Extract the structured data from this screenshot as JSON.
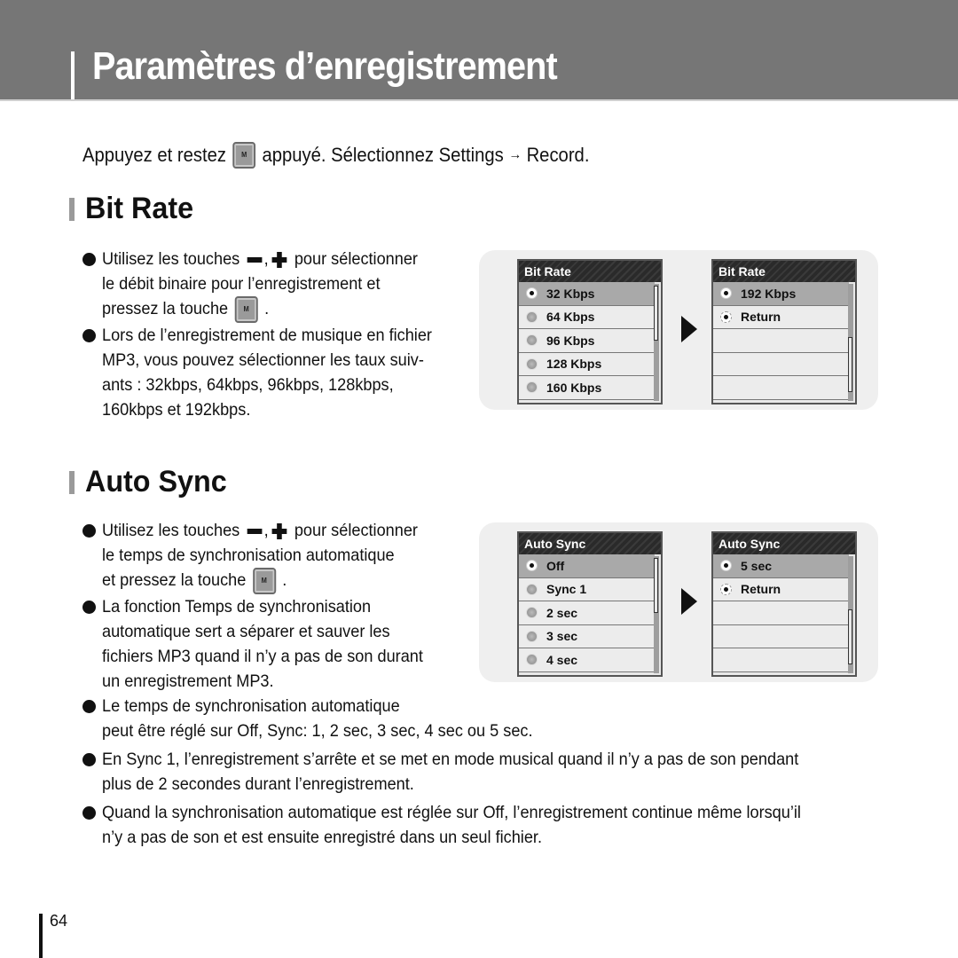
{
  "header": {
    "title": "Paramètres d’enregistrement"
  },
  "intro": {
    "before": "Appuyez et restez",
    "key": "M",
    "after": "appuyé. Sélectionnez Settings",
    "arrow": "→",
    "end": "Record."
  },
  "bitrate": {
    "title": "Bit Rate",
    "bullets": [
      {
        "lines": [
          "Utilisez les touches",
          "pour sélectionner",
          "le débit binaire pour l’enregistrement et",
          "pressez la touche",
          "."
        ]
      },
      {
        "lines": [
          "Lors de l’enregistrement de musique en fichier",
          "MP3, vous pouvez sélectionner les taux suiv-",
          "ants : 32kbps, 64kbps, 96kbps, 128kbps,",
          "160kbps et 192kbps."
        ]
      }
    ],
    "screen1": {
      "title": "Bit Rate",
      "items": [
        "32 Kbps",
        "64 Kbps",
        "96 Kbps",
        "128 Kbps",
        "160 Kbps"
      ],
      "selected": "32 Kbps"
    },
    "screen2": {
      "title": "Bit Rate",
      "items": [
        "192 Kbps",
        "Return",
        "",
        "",
        ""
      ],
      "selected": "192 Kbps"
    }
  },
  "autosync": {
    "title": "Auto Sync",
    "bullets": [
      {
        "lines": [
          "Utilisez les touches",
          "pour sélectionner",
          "le temps de synchronisation automatique",
          "et pressez la touche",
          "."
        ]
      },
      {
        "lines": [
          "La fonction Temps de synchronisation",
          "automatique sert a séparer et sauver les",
          "fichiers MP3 quand il n’y a pas de son durant",
          "un enregistrement MP3."
        ]
      },
      {
        "lines": [
          "Le temps de synchronisation automatique",
          "peut être réglé sur Off, Sync: 1, 2 sec, 3 sec, 4 sec ou 5 sec."
        ]
      },
      {
        "lines": [
          "En Sync 1, l’enregistrement s’arrête et se met en mode musical quand il n’y a pas de son pendant",
          "plus de 2 secondes durant l’enregistrement."
        ]
      },
      {
        "lines": [
          "Quand la synchronisation automatique est réglée sur Off, l’enregistrement continue même lorsqu’il",
          "n’y a pas de son et est ensuite enregistré dans un seul fichier."
        ]
      }
    ],
    "screen1": {
      "title": "Auto Sync",
      "items": [
        "Off",
        "Sync 1",
        "2 sec",
        "3 sec",
        "4 sec"
      ],
      "selected": "Off"
    },
    "screen2": {
      "title": "Auto Sync",
      "items": [
        "5 sec",
        "Return",
        "",
        "",
        ""
      ],
      "selected": "5 sec"
    }
  },
  "footer": {
    "page_number": "64"
  }
}
